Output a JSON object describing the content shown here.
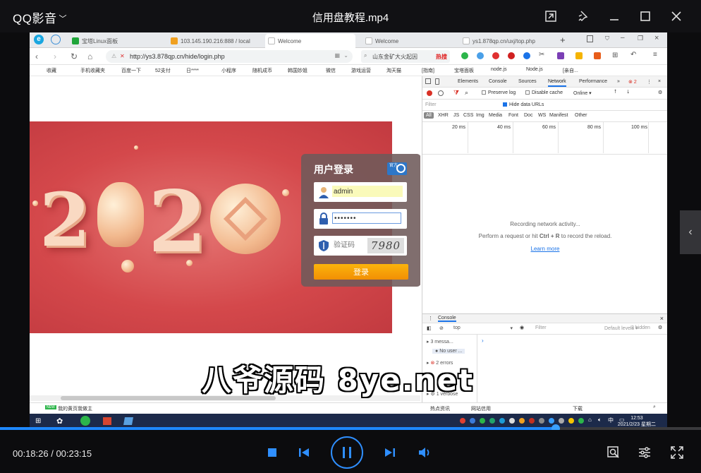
{
  "player": {
    "app_name": "QQ影音",
    "file_title": "信用盘教程.mp4",
    "time_current": "00:18:26",
    "time_total": "00:23:15",
    "progress_fraction": 0.793
  },
  "browser": {
    "tabs": [
      {
        "label": "宝塔Linux面板",
        "color": "#20a53a"
      },
      {
        "label": "103.145.190.216:888 / local",
        "color": "#f0a020"
      },
      {
        "label": "Welcome",
        "color": "#cccccc"
      },
      {
        "label": "Welcome",
        "color": "#cccccc"
      },
      {
        "label": "ys1.878qp.cn/uxj/top.php",
        "color": "#cccccc"
      }
    ],
    "url": "http://ys3.878qp.cn/hide/login.php",
    "search_text": "山东金矿大火起因",
    "search_hot": "热搜",
    "bookmarks": [
      "收藏",
      "手机收藏夹",
      "百度一下",
      "52支付",
      "日****",
      "小程序",
      "随机成币",
      "韩国妙姐",
      "微信",
      "游戏运营",
      "淘天猫",
      "[指南]",
      "宝塔面板",
      "node.js",
      "Node.js",
      "[亲自..."
    ]
  },
  "login": {
    "title": "用户登录",
    "badge": "官方",
    "username_value": "admin",
    "password_value": "•••••••",
    "captcha_placeholder": "验证码",
    "captcha_code": "7980",
    "submit_label": "登录"
  },
  "devtools": {
    "tabs": [
      "Elements",
      "Console",
      "Sources",
      "Network",
      "Performance"
    ],
    "active_tab": "Network",
    "error_count": "2",
    "preserve_log": "Preserve log",
    "disable_cache": "Disable cache",
    "throttle": "Online",
    "filter_placeholder": "Filter",
    "hide_data_urls": "Hide data URLs",
    "type_filters": [
      "All",
      "XHR",
      "JS",
      "CSS",
      "Img",
      "Media",
      "Font",
      "Doc",
      "WS",
      "Manifest",
      "Other"
    ],
    "timeline_labels": [
      "20 ms",
      "40 ms",
      "60 ms",
      "80 ms",
      "100 ms"
    ],
    "recording_text": "Recording network activity...",
    "hint_prefix": "Perform a request or hit ",
    "hint_keys": "Ctrl + R",
    "hint_suffix": " to record the reload.",
    "learn_more": "Learn more",
    "console_title": "Console",
    "console_context": "top",
    "console_filter": "Filter",
    "console_levels": "Default levels ▾",
    "console_hidden": "3 hidden",
    "console_messages": [
      "3 messa...",
      "No user ...",
      "2 errors",
      "1 verbose"
    ]
  },
  "statusbar": {
    "left_text": "我的黄页我做主",
    "right_items": [
      "热点资讯",
      "网站信用",
      "下载"
    ]
  },
  "taskbar": {
    "clock_time": "12:53",
    "clock_date": "2021/2/23 星期二"
  },
  "watermark": "八爷源码 8ye.net",
  "colors": {
    "accent": "#1e88ff",
    "login_button": "#f7a00a",
    "banner_red": "#d4484b"
  }
}
